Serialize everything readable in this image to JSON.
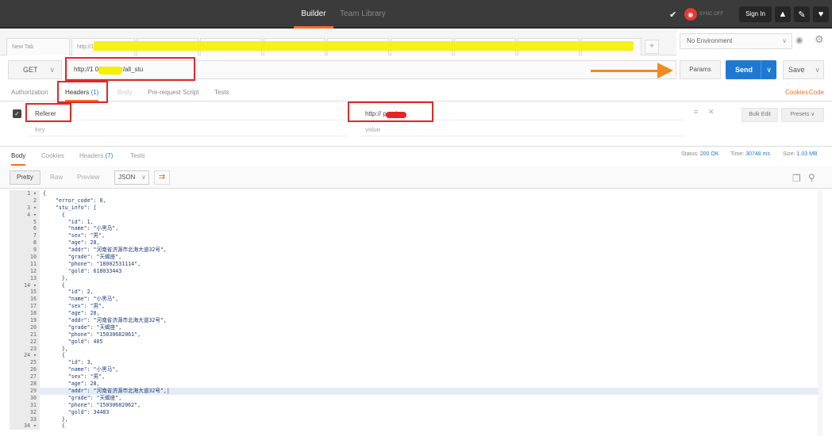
{
  "topbar": {
    "builder": "Builder",
    "team_library": "Team Library",
    "sync_label": "SYNC OFF",
    "signin": "Sign In"
  },
  "tabs": {
    "new_tab": "New Tab",
    "tab2": "http://1",
    "plus": "+"
  },
  "env": {
    "selected": "No Environment"
  },
  "request": {
    "method": "GET",
    "url": "http://1          0/api/user/all_stu",
    "params": "Params",
    "send": "Send",
    "save": "Save"
  },
  "subtabs": {
    "authorization": "Authorization",
    "headers": "Headers",
    "headers_count": "(1)",
    "body": "Body",
    "prerequest": "Pre-request Script",
    "tests": "Tests",
    "cookies": "Cookies",
    "code": "Code"
  },
  "headers_table": {
    "key1": "Referer",
    "value1": "http://                 p.cn/",
    "key_placeholder": "key",
    "value_placeholder": "value",
    "bulk_edit": "Bulk Edit",
    "presets": "Presets"
  },
  "response": {
    "body": "Body",
    "cookies": "Cookies",
    "headers": "Headers",
    "headers_count": "(7)",
    "tests": "Tests",
    "status_label": "Status:",
    "status_value": "200 OK",
    "time_label": "Time:",
    "time_value": "30748 ms",
    "size_label": "Size:",
    "size_value": "1.03 MB"
  },
  "viewbar": {
    "pretty": "Pretty",
    "raw": "Raw",
    "preview": "Preview",
    "format": "JSON"
  },
  "editor_lines": [
    {
      "n": "1 ▾",
      "t": "{"
    },
    {
      "n": "2",
      "t": "    \"error_code\": 0,"
    },
    {
      "n": "3 ▾",
      "t": "    \"stu_info\": ["
    },
    {
      "n": "4 ▾",
      "t": "      {"
    },
    {
      "n": "5",
      "t": "        \"id\": 1,"
    },
    {
      "n": "6",
      "t": "        \"name\": \"小黑马\","
    },
    {
      "n": "7",
      "t": "        \"sex\": \"男\","
    },
    {
      "n": "8",
      "t": "        \"age\": 28,"
    },
    {
      "n": "9",
      "t": "        \"addr\": \"河南省济源市北海大道32号\","
    },
    {
      "n": "10",
      "t": "        \"grade\": \"天蝎座\","
    },
    {
      "n": "11",
      "t": "        \"phone\": \"18002531114\","
    },
    {
      "n": "12",
      "t": "        \"gold\": 618033443"
    },
    {
      "n": "13",
      "t": "      },"
    },
    {
      "n": "14 ▾",
      "t": "      {"
    },
    {
      "n": "15",
      "t": "        \"id\": 2,"
    },
    {
      "n": "16",
      "t": "        \"name\": \"小黑马\","
    },
    {
      "n": "17",
      "t": "        \"sex\": \"男\","
    },
    {
      "n": "18",
      "t": "        \"age\": 28,"
    },
    {
      "n": "19",
      "t": "        \"addr\": \"河南省济源市北海大道32号\","
    },
    {
      "n": "20",
      "t": "        \"grade\": \"天蝎座\","
    },
    {
      "n": "21",
      "t": "        \"phone\": \"15030682061\","
    },
    {
      "n": "22",
      "t": "        \"gold\": 405"
    },
    {
      "n": "23",
      "t": "      },"
    },
    {
      "n": "24 ▾",
      "t": "      {"
    },
    {
      "n": "25",
      "t": "        \"id\": 3,"
    },
    {
      "n": "26",
      "t": "        \"name\": \"小黑马\","
    },
    {
      "n": "27",
      "t": "        \"sex\": \"男\","
    },
    {
      "n": "28",
      "t": "        \"age\": 28,"
    },
    {
      "n": "29",
      "t": "        \"addr\": \"河南省济源市北海大道32号\",|",
      "hl": true
    },
    {
      "n": "30",
      "t": "        \"grade\": \"天蝎座\","
    },
    {
      "n": "31",
      "t": "        \"phone\": \"15030682062\","
    },
    {
      "n": "32",
      "t": "        \"gold\": 34483"
    },
    {
      "n": "33",
      "t": "      },"
    },
    {
      "n": "34 ▾",
      "t": "      {"
    }
  ]
}
